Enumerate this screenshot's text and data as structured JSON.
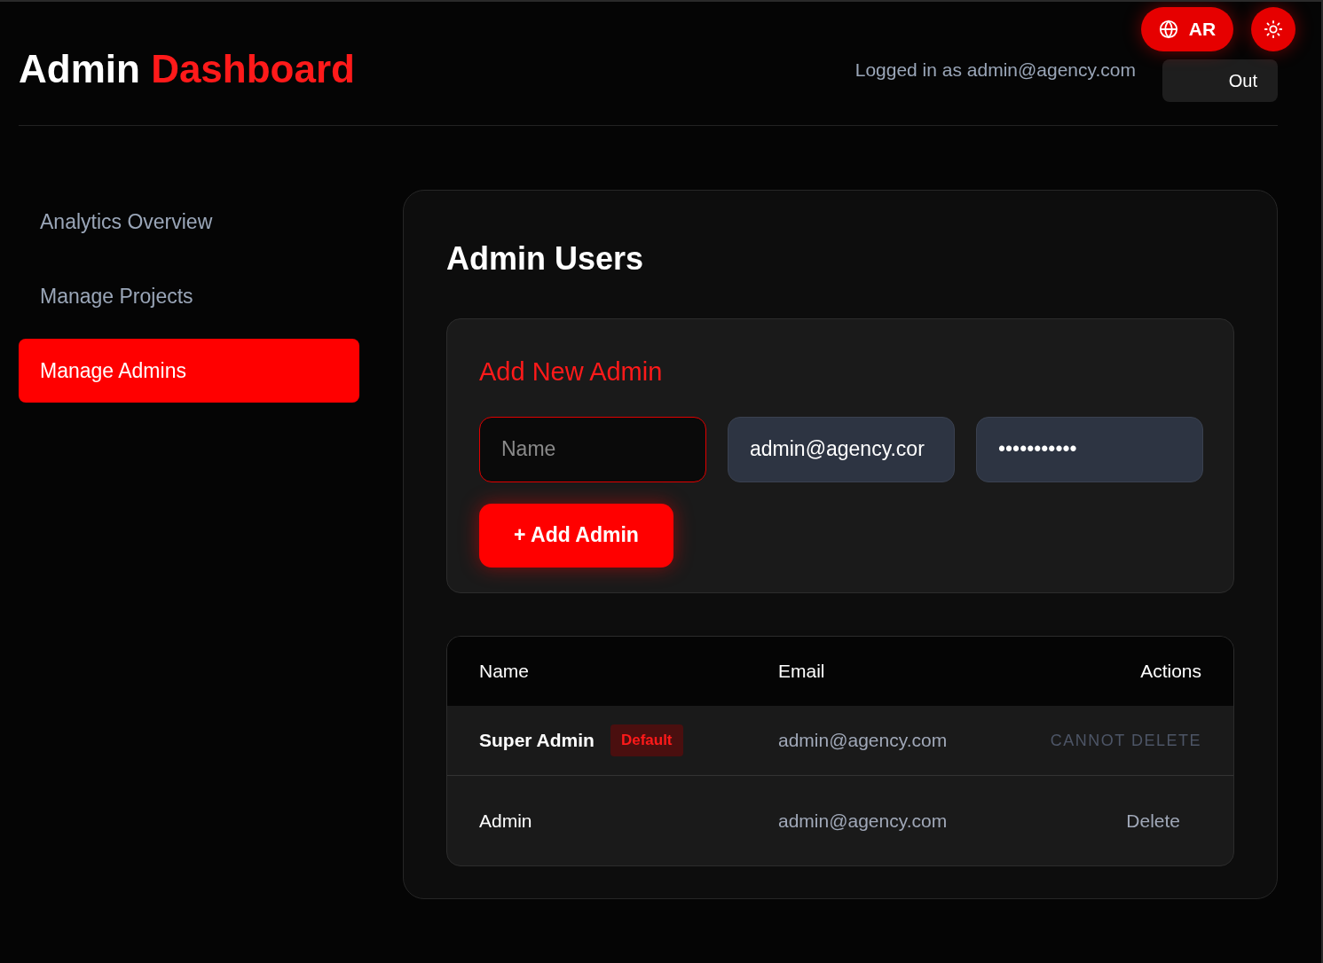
{
  "header": {
    "title": "Admin",
    "title_accent": "Dashboard",
    "logged_in": "Logged in as admin@agency.com",
    "sign_out": "Out",
    "language": "AR"
  },
  "sidebar": {
    "items": [
      {
        "label": "Analytics Overview",
        "selected": false
      },
      {
        "label": "Manage Projects",
        "selected": false
      },
      {
        "label": "Manage Admins",
        "selected": true
      }
    ]
  },
  "main": {
    "title": "Admin Users",
    "form": {
      "title": "Add New Admin",
      "fields": [
        {
          "placeholder": "Name",
          "focused": true
        },
        {
          "value": "admin@agency.cor",
          "focused": false
        },
        {
          "value": "•••••••••••",
          "focused": false
        }
      ],
      "button": "+ Add Admin"
    },
    "table": {
      "columns": [
        "Name",
        "Email",
        "Actions"
      ],
      "rows": [
        {
          "name": "Super Admin",
          "badge": "Default",
          "email": "admin@agency.com",
          "action": "CANNOT DELETE",
          "disabled": true
        },
        {
          "name": "Admin",
          "email": "admin@agency.com",
          "action": "Delete",
          "disabled": false
        }
      ]
    }
  }
}
